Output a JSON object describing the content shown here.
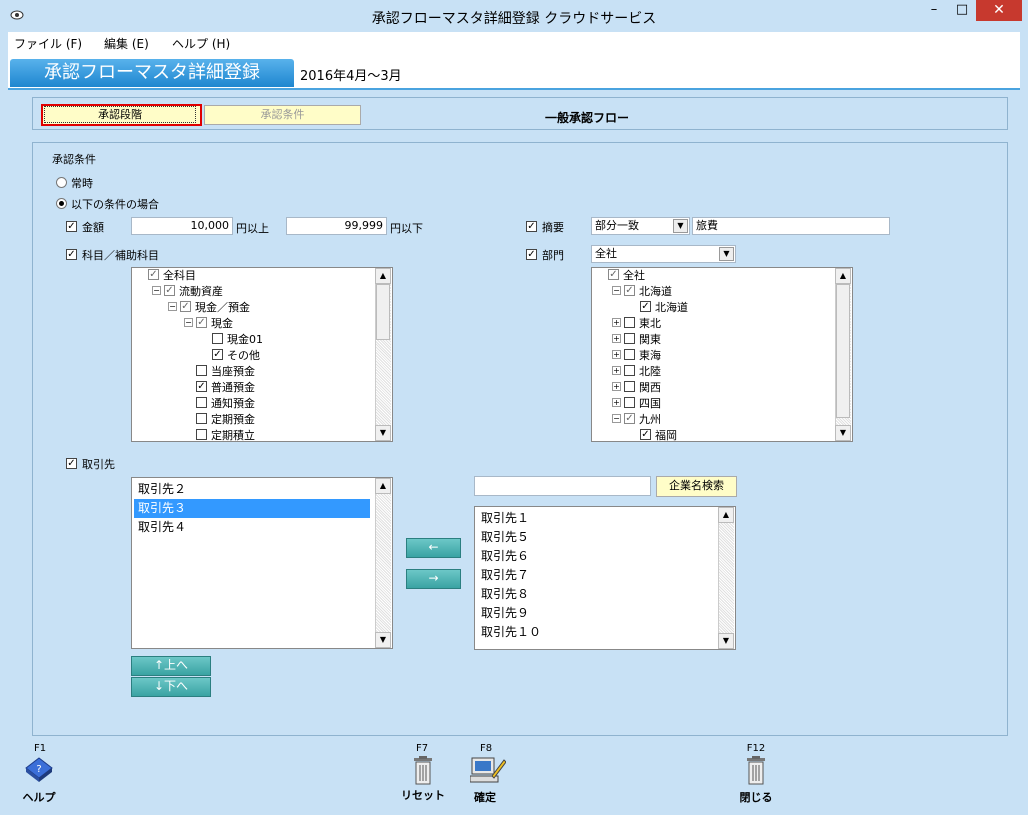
{
  "window": {
    "title": "承認フローマスタ詳細登録 クラウドサービス",
    "minimize": "–",
    "maximize": "□",
    "close": "✕"
  },
  "menu": [
    "ファイル (F)",
    "編集 (E)",
    "ヘルプ (H)"
  ],
  "header": {
    "title": "承認フローマスタ詳細登録",
    "period": "2016年4月～3月"
  },
  "tabs": {
    "stage": "承認段階",
    "condition": "承認条件",
    "flow_name": "一般承認フロー"
  },
  "conditions": {
    "section_label": "承認条件",
    "radio_always": "常時",
    "radio_if": "以下の条件の場合",
    "amount": {
      "label": "金額",
      "min": "10,000",
      "min_suffix": "円以上",
      "max": "99,999",
      "max_suffix": "円以下"
    },
    "summary": {
      "label": "摘要",
      "match": "部分一致",
      "value": "旅費"
    },
    "account": {
      "label": "科目／補助科目"
    },
    "dept": {
      "label": "部門",
      "value": "全社"
    },
    "partner": {
      "label": "取引先"
    }
  },
  "account_tree": [
    {
      "text": "全科目",
      "depth": 0,
      "checked": true,
      "gray": true,
      "exp": ""
    },
    {
      "text": "流動資産",
      "depth": 1,
      "checked": true,
      "gray": true,
      "exp": "−"
    },
    {
      "text": "現金／預金",
      "depth": 2,
      "checked": true,
      "gray": true,
      "exp": "−"
    },
    {
      "text": "現金",
      "depth": 3,
      "checked": true,
      "gray": true,
      "exp": "−"
    },
    {
      "text": "現金01",
      "depth": 4,
      "checked": false,
      "gray": false,
      "exp": ""
    },
    {
      "text": "その他",
      "depth": 4,
      "checked": true,
      "gray": false,
      "exp": ""
    },
    {
      "text": "当座預金",
      "depth": 3,
      "checked": false,
      "gray": false,
      "exp": ""
    },
    {
      "text": "普通預金",
      "depth": 3,
      "checked": true,
      "gray": false,
      "exp": ""
    },
    {
      "text": "通知預金",
      "depth": 3,
      "checked": false,
      "gray": false,
      "exp": ""
    },
    {
      "text": "定期預金",
      "depth": 3,
      "checked": false,
      "gray": false,
      "exp": ""
    },
    {
      "text": "定期積立",
      "depth": 3,
      "checked": false,
      "gray": false,
      "exp": ""
    }
  ],
  "dept_tree": [
    {
      "text": "全社",
      "depth": 0,
      "checked": true,
      "gray": true,
      "exp": ""
    },
    {
      "text": "北海道",
      "depth": 1,
      "checked": true,
      "gray": true,
      "exp": "−"
    },
    {
      "text": "北海道",
      "depth": 2,
      "checked": true,
      "gray": false,
      "exp": ""
    },
    {
      "text": "東北",
      "depth": 1,
      "checked": false,
      "gray": false,
      "exp": "+"
    },
    {
      "text": "関東",
      "depth": 1,
      "checked": false,
      "gray": false,
      "exp": "+"
    },
    {
      "text": "東海",
      "depth": 1,
      "checked": false,
      "gray": false,
      "exp": "+"
    },
    {
      "text": "北陸",
      "depth": 1,
      "checked": false,
      "gray": false,
      "exp": "+"
    },
    {
      "text": "関西",
      "depth": 1,
      "checked": false,
      "gray": false,
      "exp": "+"
    },
    {
      "text": "四国",
      "depth": 1,
      "checked": false,
      "gray": false,
      "exp": "+"
    },
    {
      "text": "九州",
      "depth": 1,
      "checked": true,
      "gray": true,
      "exp": "−"
    },
    {
      "text": "福岡",
      "depth": 2,
      "checked": true,
      "gray": false,
      "exp": ""
    }
  ],
  "partner_left": [
    "取引先２",
    "取引先３",
    "取引先４"
  ],
  "partner_left_selected": 1,
  "partner_right": [
    "取引先１",
    "取引先５",
    "取引先６",
    "取引先７",
    "取引先８",
    "取引先９",
    "取引先１０"
  ],
  "partner_search": {
    "button": "企業名検索",
    "value": ""
  },
  "move_buttons": {
    "left": "←",
    "right": "→",
    "up": "↑上へ",
    "down": "↓下へ"
  },
  "footer": [
    {
      "key": "F1",
      "label": "ヘルプ"
    },
    {
      "key": "F7",
      "label": "リセット"
    },
    {
      "key": "F8",
      "label": "確定"
    },
    {
      "key": "F12",
      "label": "閉じる"
    }
  ]
}
